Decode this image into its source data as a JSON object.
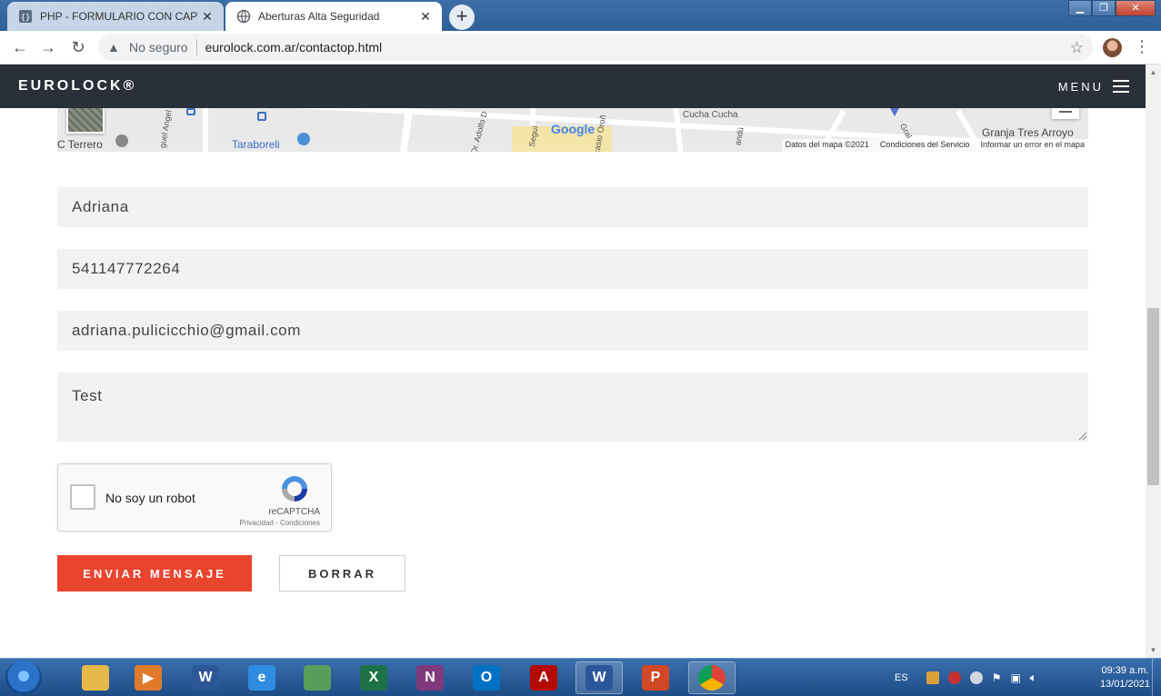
{
  "browser": {
    "tabs": [
      {
        "title": "PHP - FORMULARIO CON CAPTC",
        "close": "✕"
      },
      {
        "title": "Aberturas Alta Seguridad",
        "close": "✕"
      }
    ],
    "new_tab": "+",
    "security_label": "No seguro",
    "url": "eurolock.com.ar/contactop.html"
  },
  "site": {
    "brand": "EUROLOCK®",
    "menu_label": "MENU"
  },
  "map": {
    "labels": [
      "C Terrero",
      "Taraboreli",
      "Google",
      "Granja Tres Arroyo",
      "Cucha Cucha",
      "Dr. Adolfo D",
      "Seguí",
      "casio Oroñ",
      "guel Angel",
      "Gral",
      "andú"
    ],
    "attribution": [
      "Datos del mapa ©2021",
      "Condiciones del Servicio",
      "Informar un error en el mapa"
    ]
  },
  "form": {
    "name": "Adriana",
    "phone": "541147772264",
    "email": "adriana.pulicicchio@gmail.com",
    "message": "Test",
    "captcha_label": "No soy un robot",
    "captcha_brand": "reCAPTCHA",
    "captcha_terms": "Privacidad - Condiciones",
    "send_button": "ENVIAR MENSAJE",
    "clear_button": "BORRAR"
  },
  "taskbar": {
    "lang": "ES",
    "time": "09:39 a.m.",
    "date": "13/01/2021",
    "apps": [
      {
        "name": "explorer",
        "letter": "",
        "color": "#e6b94a"
      },
      {
        "name": "media-player",
        "letter": "▶",
        "color": "#e07a2a"
      },
      {
        "name": "word-doc",
        "letter": "W",
        "color": "#2b5797"
      },
      {
        "name": "internet-explorer",
        "letter": "e",
        "color": "#2e8de0"
      },
      {
        "name": "photo-viewer",
        "letter": "",
        "color": "#5a9c5a"
      },
      {
        "name": "excel",
        "letter": "X",
        "color": "#1e7145"
      },
      {
        "name": "onenote",
        "letter": "N",
        "color": "#80397b"
      },
      {
        "name": "outlook",
        "letter": "O",
        "color": "#0072c6"
      },
      {
        "name": "acrobat",
        "letter": "A",
        "color": "#b30b00"
      },
      {
        "name": "word",
        "letter": "W",
        "color": "#2b579a"
      },
      {
        "name": "powerpoint",
        "letter": "P",
        "color": "#d24726"
      },
      {
        "name": "chrome",
        "letter": "",
        "color": "#db4437"
      }
    ]
  }
}
